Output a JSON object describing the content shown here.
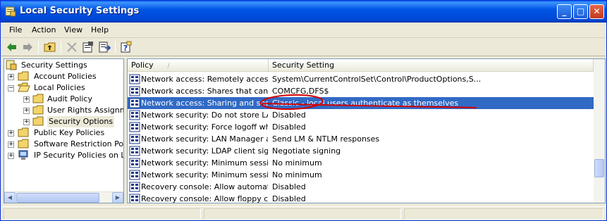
{
  "window": {
    "title": "Local Security Settings",
    "controls": {
      "minimize": "_",
      "maximize": "□",
      "close": "✕"
    }
  },
  "menubar": {
    "items": [
      "File",
      "Action",
      "View",
      "Help"
    ]
  },
  "toolbar": {
    "icons": [
      "back-arrow-icon",
      "forward-arrow-icon",
      "up-folder-icon",
      "delete-icon",
      "properties-icon",
      "export-list-icon",
      "help-icon"
    ]
  },
  "tree": {
    "root": "Security Settings",
    "items": [
      {
        "label": "Account Policies",
        "expander": "+"
      },
      {
        "label": "Local Policies",
        "expander": "−"
      },
      {
        "label": "Audit Policy",
        "expander": "+"
      },
      {
        "label": "User Rights Assignmen",
        "expander": "+"
      },
      {
        "label": "Security Options",
        "expander": ""
      },
      {
        "label": "Public Key Policies",
        "expander": "+"
      },
      {
        "label": "Software Restriction Policie",
        "expander": "+"
      },
      {
        "label": "IP Security Policies on Loca",
        "expander": ""
      }
    ]
  },
  "list": {
    "columns": {
      "policy": "Policy",
      "sort_indicator": "/",
      "setting": "Security Setting"
    },
    "rows": [
      {
        "policy": "Network access: Remotely accessi...",
        "setting": "System\\CurrentControlSet\\Control\\ProductOptions,S..."
      },
      {
        "policy": "Network access: Shares that can ...",
        "setting": "COMCFG,DFS$"
      },
      {
        "policy": "Network access: Sharing and secu...",
        "setting": "Classic - local users authenticate as themselves"
      },
      {
        "policy": "Network security: Do not store LA...",
        "setting": "Disabled"
      },
      {
        "policy": "Network security: Force logoff wh...",
        "setting": "Disabled"
      },
      {
        "policy": "Network security: LAN Manager a...",
        "setting": "Send LM & NTLM responses"
      },
      {
        "policy": "Network security: LDAP client signi...",
        "setting": "Negotiate signing"
      },
      {
        "policy": "Network security: Minimum session...",
        "setting": "No minimum"
      },
      {
        "policy": "Network security: Minimum session...",
        "setting": "No minimum"
      },
      {
        "policy": "Recovery console: Allow automati...",
        "setting": "Disabled"
      },
      {
        "policy": "Recovery console: Allow floppy co...",
        "setting": "Disabled"
      }
    ],
    "selected_index": 2
  },
  "colors": {
    "selection": "#316ac5",
    "annotation": "#d40000",
    "titlebar": "#0055e5"
  }
}
